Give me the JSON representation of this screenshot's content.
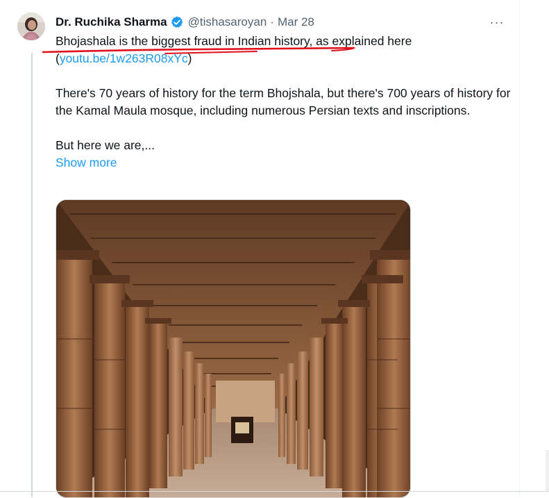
{
  "tweet": {
    "author_name": "Dr. Ruchika Sharma",
    "handle": "@tishasaroyan",
    "separator": "·",
    "date": "Mar 28",
    "more_icon": "···",
    "line1_text": "Bhojashala is the biggest fraud in Indian history, as explained here",
    "line2_open": "(",
    "link_text": "youtu.be/1w263R08xYc",
    "line2_close": ")",
    "paragraph2": "There's 70 years of history for the term Bhojshala, but there's 700 years of history for the Kamal Maula mosque, including numerous Persian texts and inscriptions.",
    "paragraph3": "But here we are,...",
    "show_more": "Show more"
  },
  "colors": {
    "link": "#1d9bf0",
    "verified_badge": "#1d9bf0",
    "annotation_underline": "#e0101c",
    "secondary_text": "#536471"
  },
  "icons": {
    "verified": "verified-badge-icon",
    "more": "more-options-icon"
  }
}
